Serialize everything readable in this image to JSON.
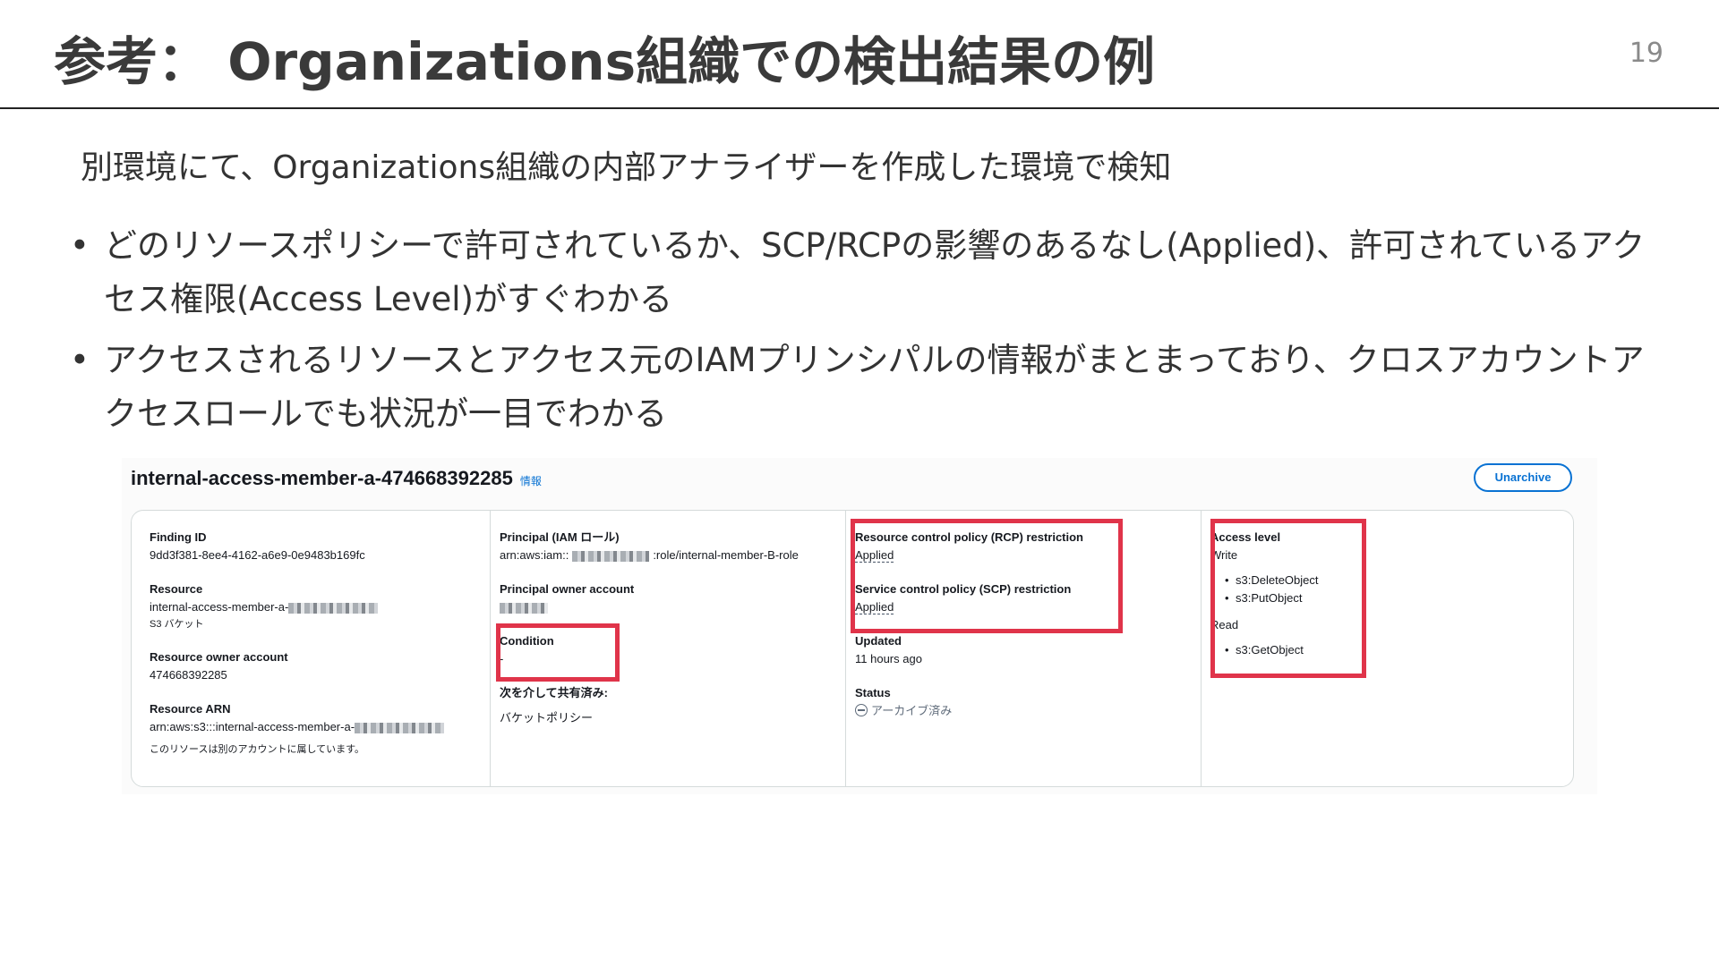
{
  "slide": {
    "title": "参考： Organizationsでの検出結果の例",
    "title_display": "参考： Organizations組織での検出結果の例",
    "page_number": "19",
    "subtitle": "別環境にて、Organizations組織の内部アナライザーを作成した環境で検知",
    "bullets": [
      "どのリソースポリシーで許可されているか、SCP/RCPの影響のあるなし(Applied)、許可されているアクセス権限(Access Level)がすぐわかる",
      "アクセスされるリソースとアクセス元のIAMプリンシパルの情報がまとまっており、クロスアカウントアクセスロールでも状況が一目でわかる"
    ]
  },
  "finding": {
    "title": "internal-access-member-a-474668392285",
    "info_link": "情報",
    "unarchive_label": "Unarchive",
    "col1": {
      "finding_id_label": "Finding ID",
      "finding_id_value": "9dd3f381-8ee4-4162-a6e9-0e9483b169fc",
      "resource_label": "Resource",
      "resource_value": "internal-access-member-a-",
      "resource_type": "S3 バケット",
      "owner_label": "Resource owner account",
      "owner_value": "474668392285",
      "arn_label": "Resource ARN",
      "arn_value": "arn:aws:s3:::internal-access-member-a-",
      "note": "このリソースは別のアカウントに属しています。"
    },
    "col2": {
      "principal_label": "Principal (IAM ロール)",
      "principal_prefix": "arn:aws:iam::",
      "principal_suffix": ":role/internal-member-B-role",
      "principal_owner_label": "Principal owner account",
      "condition_label": "Condition",
      "condition_value": "-",
      "shared_via_label": "次を介して共有済み:",
      "shared_via_value": "バケットポリシー"
    },
    "col3": {
      "rcp_label": "Resource control policy (RCP) restriction",
      "rcp_value": "Applied",
      "scp_label": "Service control policy (SCP) restriction",
      "scp_value": "Applied",
      "updated_label": "Updated",
      "updated_value": "11 hours ago",
      "status_label": "Status",
      "status_value": "アーカイブ済み"
    },
    "col4": {
      "access_level_label": "Access level",
      "write_label": "Write",
      "write_actions": [
        "s3:DeleteObject",
        "s3:PutObject"
      ],
      "read_label": "Read",
      "read_actions": [
        "s3:GetObject"
      ]
    }
  },
  "colors": {
    "highlight": "#e0344a",
    "link": "#0972d3",
    "text": "#16191f"
  }
}
